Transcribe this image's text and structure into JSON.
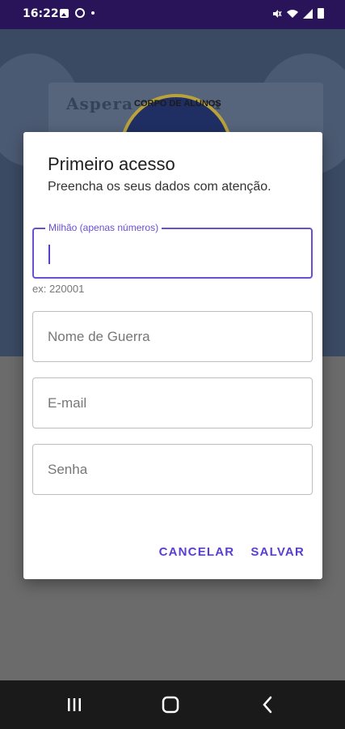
{
  "status_bar": {
    "time": "16:22",
    "icons": [
      "image-icon",
      "whatsapp-icon",
      "dot-icon",
      "mute-icon",
      "wifi-icon",
      "signal-icon",
      "battery-icon"
    ]
  },
  "background": {
    "emblem_text": "CORPO DE ALUNOS",
    "banner_text": "Aspera ad Astra"
  },
  "dialog": {
    "title": "Primeiro acesso",
    "subtitle": "Preencha os seus dados com atenção.",
    "fields": [
      {
        "label": "Milhão (apenas números)",
        "value": "",
        "helper": "ex: 220001",
        "focused": true
      },
      {
        "placeholder": "Nome de Guerra",
        "value": ""
      },
      {
        "placeholder": "E-mail",
        "value": ""
      },
      {
        "placeholder": "Senha",
        "value": ""
      }
    ],
    "actions": {
      "cancel": "CANCELAR",
      "save": "SALVAR"
    }
  },
  "nav_bar": {
    "icons": [
      "recents-icon",
      "home-icon",
      "back-icon"
    ]
  },
  "colors": {
    "accent": "#6a4fd3",
    "status_bar": "#2a1459",
    "scrim": "#6b6b6b"
  }
}
